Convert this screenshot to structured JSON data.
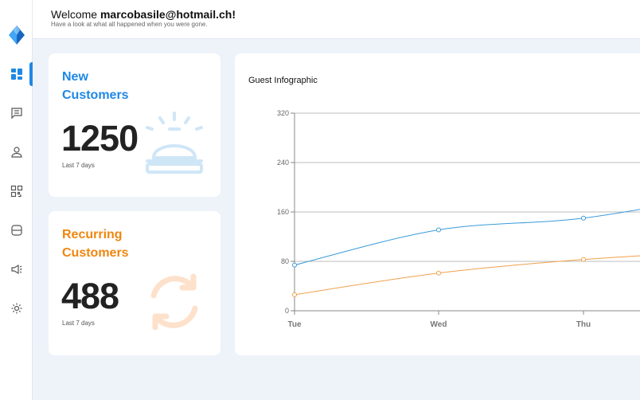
{
  "header": {
    "welcome_prefix": "Welcome ",
    "user_email": "marcobasile@hotmail.ch!",
    "subtitle": "Have a look at what all happened when you were gone."
  },
  "sidebar": {
    "items": [
      {
        "name": "dashboard",
        "icon": "dashboard-icon",
        "active": true
      },
      {
        "name": "messages",
        "icon": "chat-icon",
        "active": false
      },
      {
        "name": "profile",
        "icon": "user-icon",
        "active": false
      },
      {
        "name": "qr",
        "icon": "qr-code-icon",
        "active": false
      },
      {
        "name": "database",
        "icon": "database-icon",
        "active": false
      },
      {
        "name": "campaigns",
        "icon": "megaphone-icon",
        "active": false
      },
      {
        "name": "settings",
        "icon": "gear-icon",
        "active": false
      }
    ]
  },
  "new_customers": {
    "title": "New Customers",
    "value": "1250",
    "period": "Last 7 days",
    "color": "#1e88e5",
    "icon": "service-bell-icon"
  },
  "recurring_customers": {
    "title": "Recurring Customers",
    "value": "488",
    "period": "Last 7 days",
    "color": "#f0860f",
    "icon": "refresh-icon"
  },
  "chart": {
    "title": "Guest Infographic"
  },
  "chart_data": {
    "type": "line",
    "title": "Guest Infographic",
    "categories": [
      "Tue",
      "Wed",
      "Thu"
    ],
    "y_ticks": [
      0,
      80,
      160,
      240,
      320
    ],
    "ylim": [
      0,
      320
    ],
    "grid": true,
    "series": [
      {
        "color": "#3a9ad9",
        "values": [
          74,
          131,
          150
        ]
      },
      {
        "color": "#f0a04b",
        "values": [
          26,
          61,
          83
        ]
      }
    ]
  }
}
